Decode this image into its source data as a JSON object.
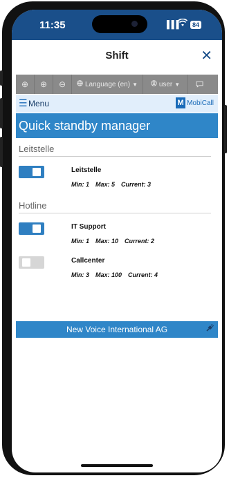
{
  "status_bar": {
    "time": "11:35",
    "signal": "▐▐▐",
    "battery": "84"
  },
  "sheet": {
    "title": "Shift",
    "close": "✕"
  },
  "toolbar": {
    "zoom_in_1": "⊕",
    "zoom_in_2": "⊕",
    "zoom_out": "⊖",
    "language_label": "Language (en)",
    "user_label": "user"
  },
  "menu": {
    "label": "Menu",
    "logo_mark": "M",
    "logo_name": "MobiCall"
  },
  "page": {
    "title": "Quick standby manager"
  },
  "sections": [
    {
      "title": "Leitstelle",
      "entries": [
        {
          "name": "Leitstelle",
          "enabled": true,
          "min": "Min: 1",
          "max": "Max: 5",
          "current": "Current: 3"
        }
      ]
    },
    {
      "title": "Hotline",
      "entries": [
        {
          "name": "IT Support",
          "enabled": true,
          "min": "Min: 1",
          "max": "Max: 10",
          "current": "Current: 2"
        },
        {
          "name": "Callcenter",
          "enabled": false,
          "min": "Min: 3",
          "max": "Max: 100",
          "current": "Current: 4"
        }
      ]
    }
  ],
  "footer": {
    "company": "New Voice International AG"
  },
  "colors": {
    "accent": "#2f86c8",
    "status_bar": "#1a4f8a",
    "toggle_on": "#2f7fc1",
    "toggle_off": "#d6d6d6"
  }
}
